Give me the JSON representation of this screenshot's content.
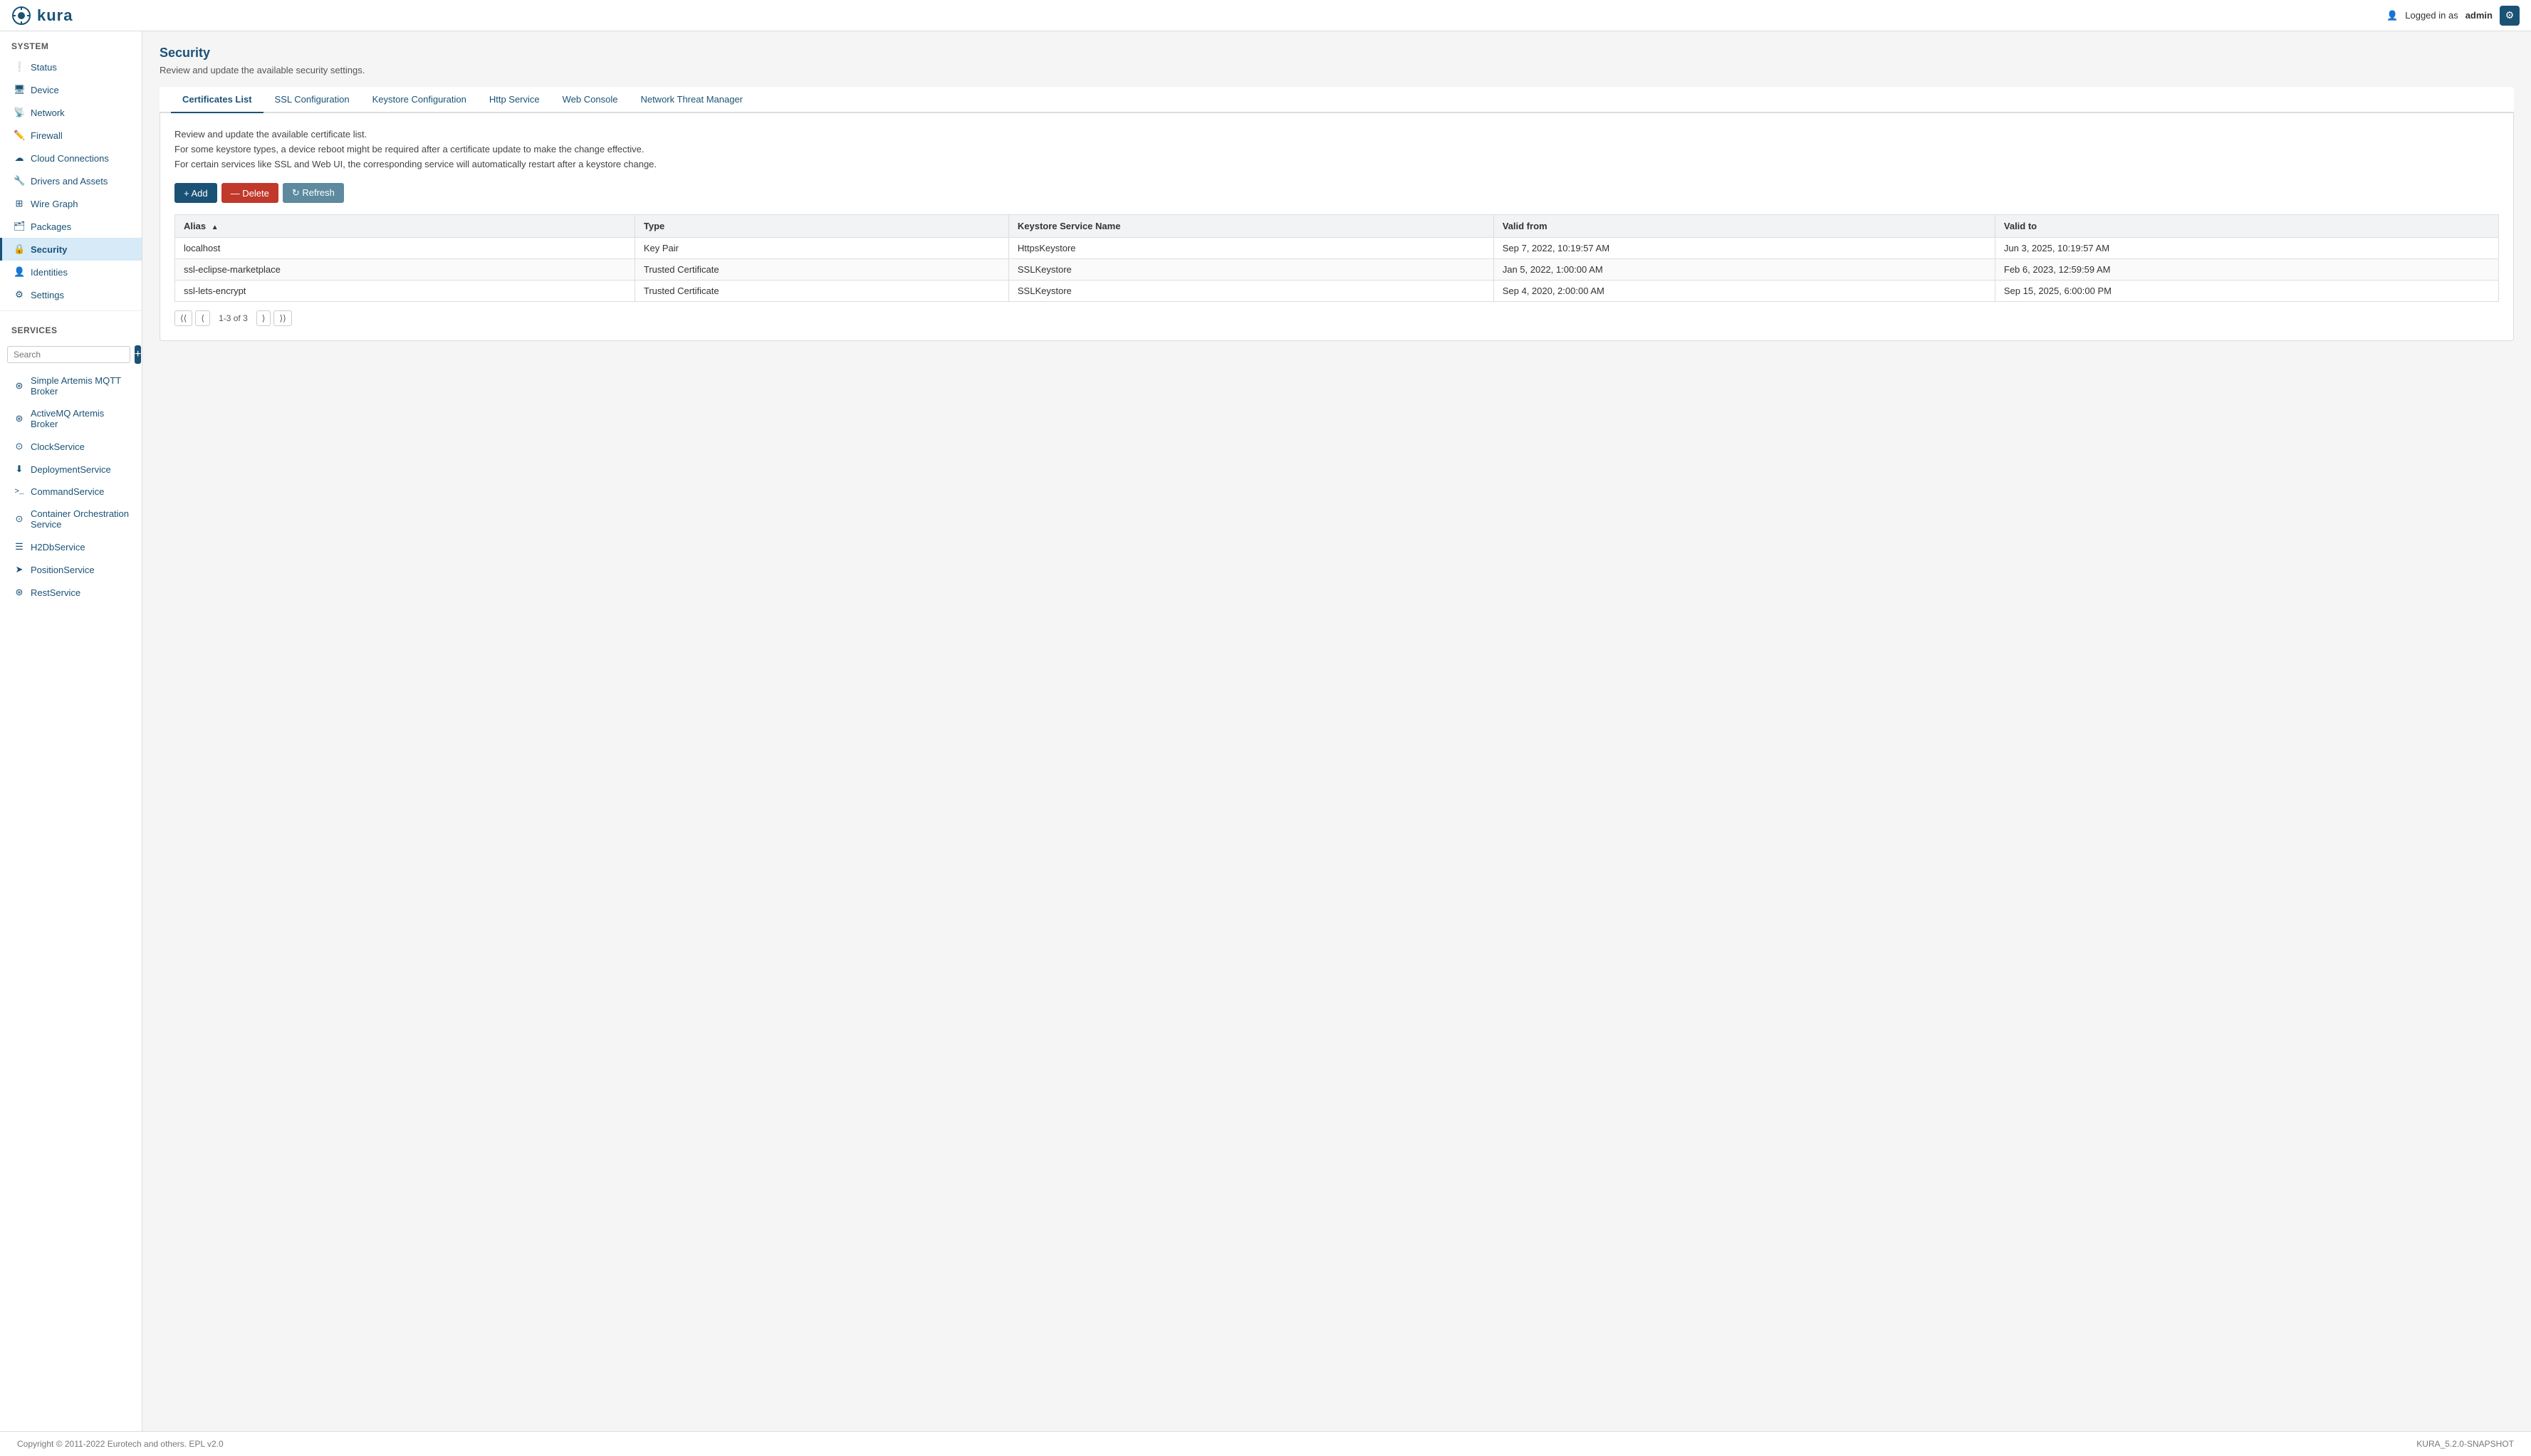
{
  "header": {
    "logo_text": "kura",
    "logged_in_text": "Logged in as",
    "username": "admin"
  },
  "sidebar": {
    "system_title": "System",
    "nav_items": [
      {
        "id": "status",
        "label": "Status",
        "icon": "!",
        "active": false
      },
      {
        "id": "device",
        "label": "Device",
        "icon": "▣",
        "active": false
      },
      {
        "id": "network",
        "label": "Network",
        "icon": "📶",
        "active": false
      },
      {
        "id": "firewall",
        "label": "Firewall",
        "icon": "✏",
        "active": false
      },
      {
        "id": "cloud-connections",
        "label": "Cloud Connections",
        "icon": "☁",
        "active": false
      },
      {
        "id": "drivers-assets",
        "label": "Drivers and Assets",
        "icon": "🔧",
        "active": false
      },
      {
        "id": "wire-graph",
        "label": "Wire Graph",
        "icon": "⊞",
        "active": false
      },
      {
        "id": "packages",
        "label": "Packages",
        "icon": "🗂",
        "active": false
      },
      {
        "id": "security",
        "label": "Security",
        "icon": "🔒",
        "active": true
      },
      {
        "id": "identities",
        "label": "Identities",
        "icon": "👤",
        "active": false
      },
      {
        "id": "settings",
        "label": "Settings",
        "icon": "⚙",
        "active": false
      }
    ],
    "services_title": "Services",
    "search_placeholder": "Search",
    "services": [
      {
        "id": "artemis-mqtt",
        "label": "Simple Artemis MQTT Broker",
        "icon": "⊛"
      },
      {
        "id": "activemq-artemis",
        "label": "ActiveMQ Artemis Broker",
        "icon": "⊛"
      },
      {
        "id": "clock-service",
        "label": "ClockService",
        "icon": "⊙"
      },
      {
        "id": "deployment-service",
        "label": "DeploymentService",
        "icon": "⬇"
      },
      {
        "id": "command-service",
        "label": "CommandService",
        "icon": ">_"
      },
      {
        "id": "container-orchestration",
        "label": "Container Orchestration Service",
        "icon": "⊙"
      },
      {
        "id": "h2db-service",
        "label": "H2DbService",
        "icon": "☰"
      },
      {
        "id": "position-service",
        "label": "PositionService",
        "icon": "➤"
      },
      {
        "id": "rest-service",
        "label": "RestService",
        "icon": "⊛"
      }
    ]
  },
  "page": {
    "title": "Security",
    "subtitle": "Review and update the available security settings."
  },
  "tabs": [
    {
      "id": "certificates-list",
      "label": "Certificates List",
      "active": true
    },
    {
      "id": "ssl-configuration",
      "label": "SSL Configuration",
      "active": false
    },
    {
      "id": "keystore-configuration",
      "label": "Keystore Configuration",
      "active": false
    },
    {
      "id": "http-service",
      "label": "Http Service",
      "active": false
    },
    {
      "id": "web-console",
      "label": "Web Console",
      "active": false
    },
    {
      "id": "network-threat-manager",
      "label": "Network Threat Manager",
      "active": false
    }
  ],
  "panel": {
    "description_line1": "Review and update the available certificate list.",
    "description_line2": "For some keystore types, a device reboot might be required after a certificate update to make the change effective.",
    "description_line3": "For certain services like SSL and Web UI, the corresponding service will automatically restart after a keystore change.",
    "buttons": {
      "add": "+ Add",
      "delete": "— Delete",
      "refresh": "↻ Refresh"
    }
  },
  "table": {
    "columns": [
      {
        "id": "alias",
        "label": "Alias",
        "sortable": true,
        "sort_dir": "asc"
      },
      {
        "id": "type",
        "label": "Type",
        "sortable": false
      },
      {
        "id": "keystore_service_name",
        "label": "Keystore Service Name",
        "sortable": false
      },
      {
        "id": "valid_from",
        "label": "Valid from",
        "sortable": false
      },
      {
        "id": "valid_to",
        "label": "Valid to",
        "sortable": false
      }
    ],
    "rows": [
      {
        "alias": "localhost",
        "type": "Key Pair",
        "keystore_service_name": "HttpsKeystore",
        "valid_from": "Sep 7, 2022, 10:19:57 AM",
        "valid_to": "Jun 3, 2025, 10:19:57 AM"
      },
      {
        "alias": "ssl-eclipse-marketplace",
        "type": "Trusted Certificate",
        "keystore_service_name": "SSLKeystore",
        "valid_from": "Jan 5, 2022, 1:00:00 AM",
        "valid_to": "Feb 6, 2023, 12:59:59 AM"
      },
      {
        "alias": "ssl-lets-encrypt",
        "type": "Trusted Certificate",
        "keystore_service_name": "SSLKeystore",
        "valid_from": "Sep 4, 2020, 2:00:00 AM",
        "valid_to": "Sep 15, 2025, 6:00:00 PM"
      }
    ]
  },
  "pagination": {
    "info": "1-3 of 3"
  },
  "footer": {
    "copyright": "Copyright © 2011-2022 Eurotech and others. EPL v2.0",
    "version": "KURA_5.2.0-SNAPSHOT"
  }
}
